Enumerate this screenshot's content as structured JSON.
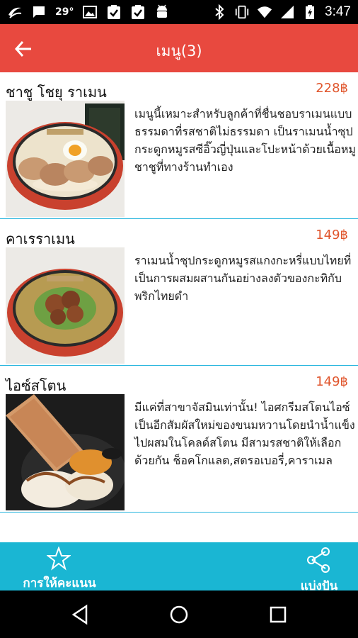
{
  "status_bar": {
    "temperature": "29°",
    "time": "3:47",
    "icons_left": [
      "app-icon",
      "message-icon",
      "temperature",
      "image-icon",
      "clipboard-check-icon",
      "clipboard-check-icon",
      "android-icon"
    ],
    "icons_right": [
      "bluetooth-icon",
      "vibrate-icon",
      "wifi-icon",
      "signal-icon",
      "battery-charging-icon"
    ]
  },
  "app_bar": {
    "title": "เมนู(3)",
    "back_icon": "arrow-back-icon",
    "color": "#E8493F"
  },
  "menu": {
    "items": [
      {
        "name": "ชาชู โชยุ ราเมน",
        "price": "228฿",
        "description": "เมนูนี้เหมาะสำหรับลูกค้าที่ชื่นชอบราเมนแบบธรรมดาที่รสชาติไม่ธรรมดา เป็นราเมนน้ำซุปกระดูกหมูรสซีอิ๊วญี่ปุ่นและโปะหน้าด้วยเนื้อหมูชาชูที่ทางร้านทำเอง",
        "image": "chashu-shoyu-ramen-photo"
      },
      {
        "name": "คาเรราเมน",
        "price": "149฿",
        "description": "ราเมนน้ำซุปกระดูกหมูรสแกงกะหรี่แบบไทยที่เป็นการผสมผสานกันอย่างลงตัวของกะทิกับพริกไทยดำ",
        "image": "curry-ramen-photo"
      },
      {
        "name": "ไอซ์สโตน",
        "price": "149฿",
        "description": "มีแค่ที่สาขาจัสมินเท่านั้น! ไอศกรีมสโตนไอซ์เป็นอีกสัมผัสใหม่ของขนมหวานโดยนำน้ำแข็งไปผสมในโคลด์สโตน มีสามรสชาติให้เลือกด้วยกัน ช็อคโกแลต,สตรอเบอรี่,คาราเมล",
        "image": "ice-stone-dessert-photo"
      }
    ],
    "price_color": "#E0552C",
    "divider_color": "#29B6DE"
  },
  "bottom_bar": {
    "rate_label": "การให้คะแนน",
    "rate_icon": "star-outline-icon",
    "share_label": "แบ่งปัน",
    "share_icon": "share-icon",
    "color": "#1AB6D3"
  },
  "nav_bar": {
    "buttons": [
      "back-triangle-icon",
      "home-circle-icon",
      "recents-square-icon"
    ]
  }
}
